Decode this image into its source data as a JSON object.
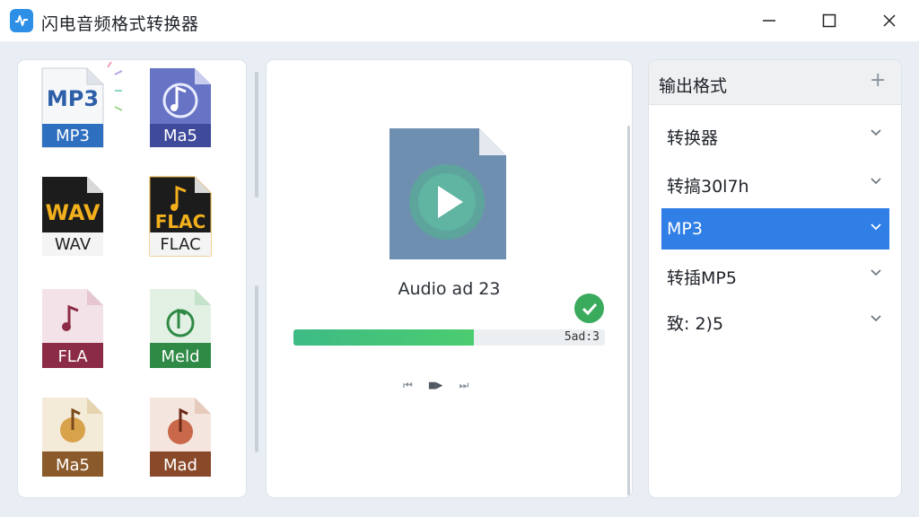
{
  "window": {
    "title": "闪电音频格式转换器"
  },
  "formats": [
    {
      "label": "MP3",
      "badge": "MP3"
    },
    {
      "label": "Ma5"
    },
    {
      "label": "WAV",
      "badge": "WAV"
    },
    {
      "label": "FLAC",
      "badge": "FLAC"
    },
    {
      "label": "FLA"
    },
    {
      "label": "Meld"
    },
    {
      "label": "Ma5"
    },
    {
      "label": "Mad"
    }
  ],
  "player": {
    "track_name": "Audio ad 23",
    "progress_percent": 58,
    "progress_text": "5ad:3",
    "status": "completed",
    "controls": [
      "⏮",
      "■▶",
      "⏭"
    ]
  },
  "output_panel": {
    "title": "输出格式",
    "add_label": "+",
    "options": [
      {
        "label": "转换器",
        "selected": false
      },
      {
        "label": "转搞30l7h",
        "selected": false
      },
      {
        "label": "MP3",
        "selected": true
      },
      {
        "label": "转插MP5",
        "selected": false
      },
      {
        "label": "致: 2)5",
        "selected": false
      }
    ]
  },
  "colors": {
    "accent": "#2f7fe6",
    "success": "#3aaa5c",
    "progress": "#45c47a"
  }
}
